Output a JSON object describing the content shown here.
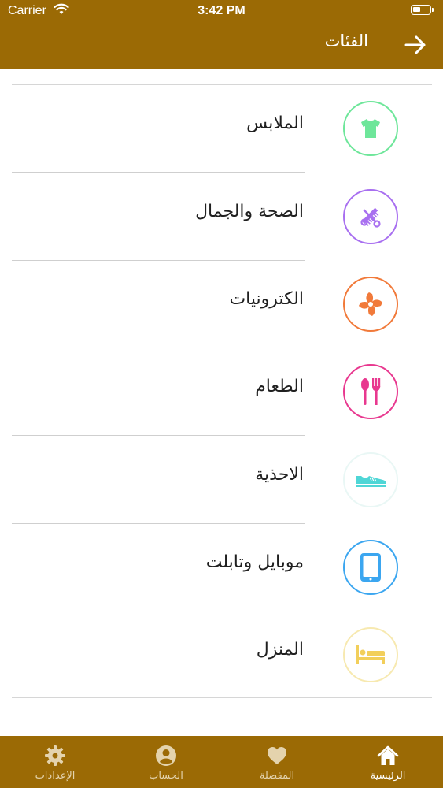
{
  "status_bar": {
    "carrier": "Carrier",
    "time": "3:42 PM"
  },
  "header": {
    "title": "الفئات"
  },
  "categories": [
    {
      "label": "الملابس",
      "icon": "tshirt-icon",
      "color": "#6ee69a"
    },
    {
      "label": "الصحة والجمال",
      "icon": "comb-scissors-icon",
      "color": "#a86ff0"
    },
    {
      "label": "الكترونيات",
      "icon": "fan-icon",
      "color": "#f17a3a"
    },
    {
      "label": "الطعام",
      "icon": "spoon-fork-icon",
      "color": "#e8388f"
    },
    {
      "label": "الاحذية",
      "icon": "shoe-icon",
      "color": "#4fd6d6"
    },
    {
      "label": "موبايل وتابلت",
      "icon": "tablet-icon",
      "color": "#3ba6f0"
    },
    {
      "label": "المنزل",
      "icon": "bed-icon",
      "color": "#f2cf5b"
    }
  ],
  "tabs": [
    {
      "label": "الرئيسية",
      "icon": "home-icon",
      "active": true
    },
    {
      "label": "المفضلة",
      "icon": "heart-icon",
      "active": false
    },
    {
      "label": "الحساب",
      "icon": "user-icon",
      "active": false
    },
    {
      "label": "الإعدادات",
      "icon": "gear-icon",
      "active": false
    }
  ],
  "colors": {
    "brand": "#9b6a05",
    "tab_inactive": "#e4d3ad"
  }
}
